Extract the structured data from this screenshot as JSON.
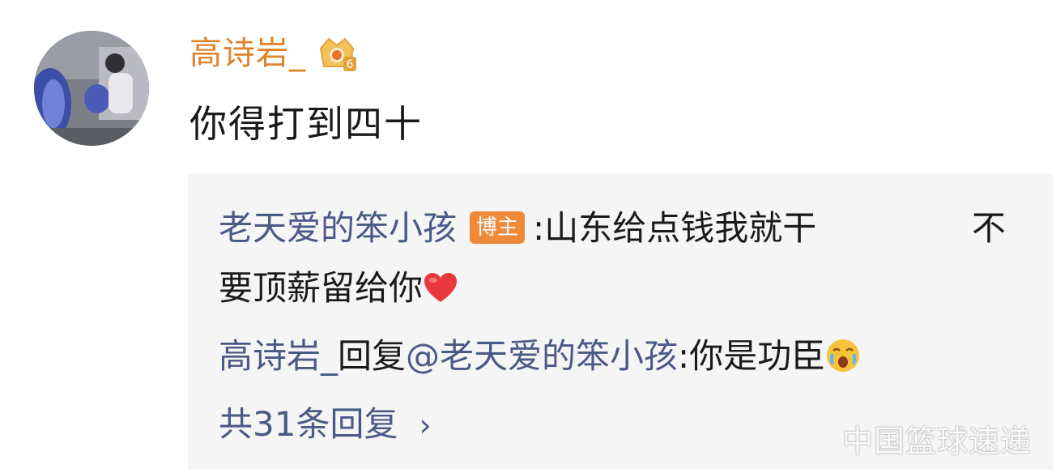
{
  "comment": {
    "username": "高诗岩_",
    "text": "你得打到四十",
    "level_badge_icon": "level-crown-badge",
    "level_number": "6"
  },
  "reply_thread": {
    "first_reply": {
      "author": "老天爱的笨小孩",
      "host_tag": "博主",
      "separator": ":",
      "text_part1": "山东给点钱我就干",
      "text_part2": "不",
      "text_line2": "要顶薪留给你",
      "emoji": "heart-icon"
    },
    "second_reply": {
      "author": "高诗岩_",
      "reply_word": "回复",
      "mention": "@老天爱的笨小孩",
      "separator": ":",
      "text": "你是功臣",
      "emoji": "crying-face-icon"
    },
    "more_replies_label": "共31条回复",
    "chevron": "›"
  },
  "watermark": "中国篮球速递",
  "colors": {
    "username": "#e0822a",
    "link_name": "#4a5a86",
    "host_tag_bg": "#ef8a3a",
    "reply_bg": "#f5f5f5",
    "text": "#1a1a1a"
  }
}
